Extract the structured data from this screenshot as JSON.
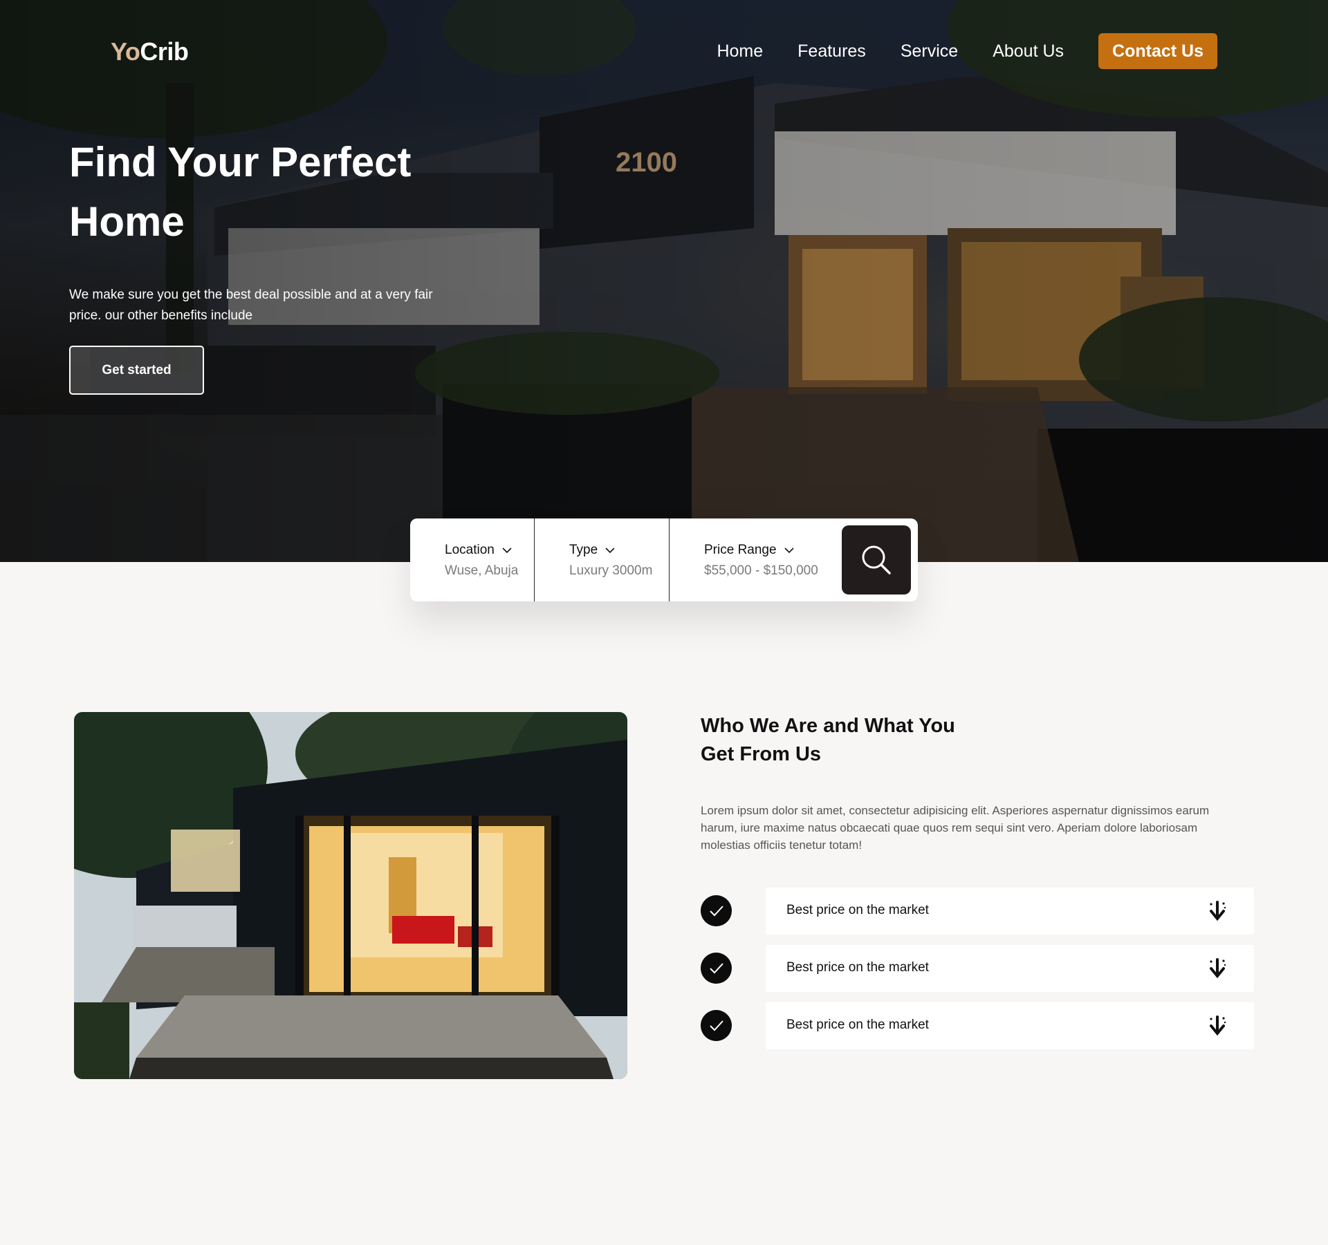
{
  "brand": {
    "logo_part1": "Yo",
    "logo_part2": "Crib"
  },
  "nav": {
    "items": [
      "Home",
      "Features",
      "Service",
      "About Us"
    ],
    "contact_label": "Contact Us"
  },
  "hero": {
    "title": "Find Your Perfect Home",
    "subtitle": "We make sure you get the best deal possible and at a very fair price. our other benefits include",
    "cta_label": "Get started",
    "sign_text": "2100"
  },
  "search": {
    "location": {
      "label": "Location",
      "value": "Wuse, Abuja"
    },
    "type": {
      "label": "Type",
      "value": "Luxury 3000m"
    },
    "price": {
      "label": "Price Range",
      "value": "$55,000 - $150,000"
    },
    "button_icon": "search-icon"
  },
  "about": {
    "title": "Who We Are and What You Get From Us",
    "body": "Lorem ipsum dolor sit amet, consectetur adipisicing elit. Asperiores aspernatur dignissimos earum harum, iure maxime natus obcaecati quae quos rem sequi sint vero. Aperiam dolore laboriosam molestias officiis tenetur totam!",
    "benefits": [
      {
        "label": "Best price on the market",
        "icon": "down-arrow-icon"
      },
      {
        "label": "Best price on the market",
        "icon": "down-arrow-icon"
      },
      {
        "label": "Best price on the market",
        "icon": "down-arrow-icon"
      }
    ]
  },
  "colors": {
    "accent": "#c47011",
    "logo_yo": "#d9b99b",
    "search_button": "#221d1c",
    "page_bg": "#f8f5f5"
  }
}
